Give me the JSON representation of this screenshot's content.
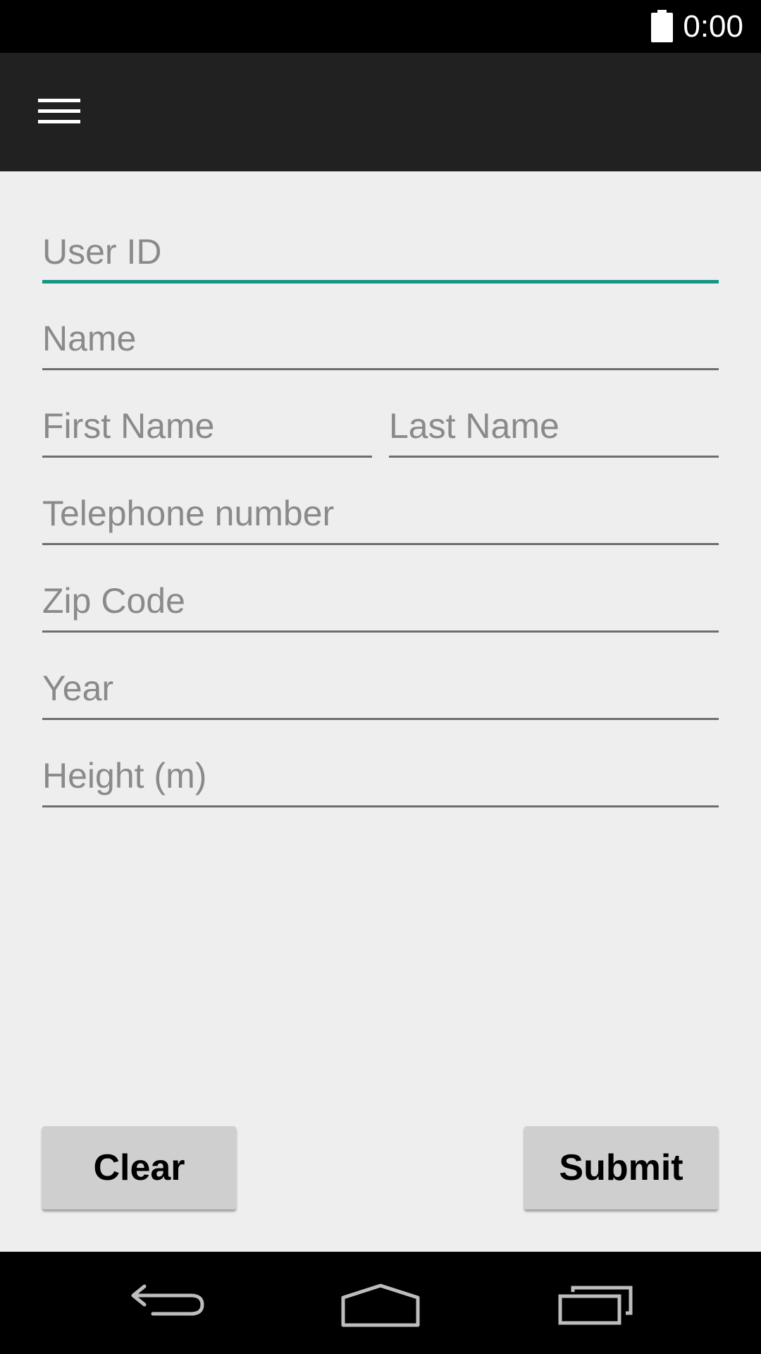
{
  "status_bar": {
    "time": "0:00",
    "battery_icon": "battery-full-icon"
  },
  "toolbar": {
    "menu_icon": "hamburger-menu-icon"
  },
  "form": {
    "user_id_placeholder": "User ID",
    "name_placeholder": "Name",
    "first_name_placeholder": "First Name",
    "last_name_placeholder": "Last Name",
    "telephone_placeholder": "Telephone number",
    "zip_code_placeholder": "Zip Code",
    "year_placeholder": "Year",
    "height_placeholder": "Height (m)"
  },
  "buttons": {
    "clear_label": "Clear",
    "submit_label": "Submit"
  },
  "nav_bar": {
    "back_icon": "back-icon",
    "home_icon": "home-icon",
    "recents_icon": "recent-apps-icon"
  },
  "colors": {
    "accent": "#149683",
    "toolbar": "#212121",
    "background": "#eeeeee",
    "button": "#cfcfcf"
  }
}
